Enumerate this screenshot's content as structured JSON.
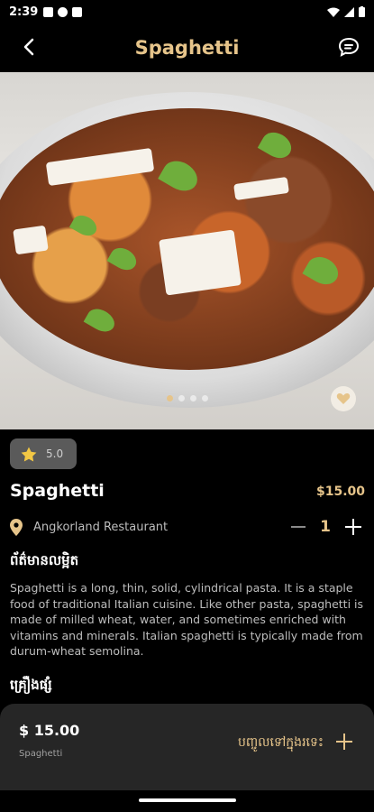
{
  "status": {
    "time": "2:39"
  },
  "header": {
    "title": "Spaghetti"
  },
  "gallery": {
    "pages": 4,
    "active_page": 1
  },
  "rating": {
    "value": "5.0"
  },
  "dish": {
    "name": "Spaghetti",
    "price": "$15.00"
  },
  "restaurant": {
    "name": "Angkorland Restaurant"
  },
  "quantity": {
    "value": "1"
  },
  "details": {
    "title": "ព័ត៌មានលម្អិត",
    "description": "Spaghetti is a long, thin, solid, cylindrical pasta. It is a staple food of traditional Italian cuisine. Like other pasta, spaghetti is made of milled wheat, water, and sometimes enriched with vitamins and minerals. Italian spaghetti is typically made from durum-wheat semolina."
  },
  "ingredients": {
    "title": "គ្រឿងផ្សំ"
  },
  "bottom_bar": {
    "price": "$ 15.00",
    "dish": "Spaghetti",
    "add_label": "បញ្ចូលទៅក្នុងរទេះ"
  },
  "colors": {
    "accent": "#e6c48a",
    "background": "#000000",
    "card": "#262626"
  }
}
